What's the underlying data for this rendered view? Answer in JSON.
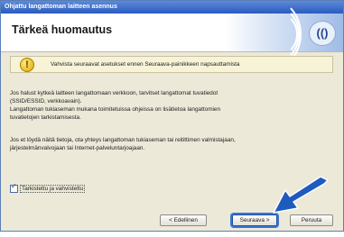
{
  "window": {
    "title": "Ohjattu langattoman laitteen asennus",
    "header_title": "Tärkeä huomautus",
    "logo_text": "(()"
  },
  "notice": {
    "text": "Vahvista seuraavat asetukset ennen Seuraava-painikkeen napsauttamista"
  },
  "body": {
    "p1_line1": "Jos halust kytkeä laitteen langattomaan verkkoon, tarvitset langattomat tuvatiedot",
    "p1_line2": "(SSID/ESSID, verkkoavain).",
    "p1_line3": "Langattoman tukiaseman mukana toimitetuissa ohjeissa on lisätietoa langattomien",
    "p1_line4": "tuvatietojen tarkistamisesta.",
    "p2_line1": "Jos et löydä näitä tietoja, ota yhteys langattoman tukiaseman tai reitittimen valmistajaan,",
    "p2_line2": "järjestelmänvalvojaan tai Internet-palveluntarjoajaan."
  },
  "checkbox": {
    "label": "Tarkistettu ja vahvistettu",
    "checked": true
  },
  "buttons": {
    "back": "< Edellinen",
    "next": "Seuraava >",
    "cancel": "Peruuta"
  },
  "colors": {
    "arrow": "#1e5bbf",
    "titlebar": "#2a5bc0"
  }
}
